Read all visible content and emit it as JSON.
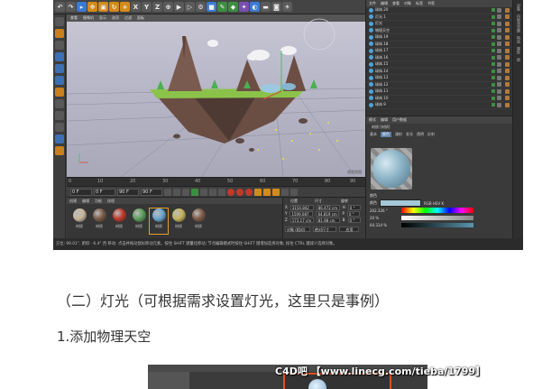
{
  "toolbar": {
    "axis_x": "X",
    "axis_y": "Y",
    "axis_z": "Z"
  },
  "viewport": {
    "menu": [
      "查看",
      "摄像机",
      "显示",
      "选项",
      "过滤",
      "面板"
    ],
    "label": "透视视图"
  },
  "timeline": {
    "ticks": [
      "0",
      "10",
      "20",
      "30",
      "40",
      "50",
      "60",
      "70",
      "80",
      "90"
    ],
    "frame_end_label": "0 F"
  },
  "transport": {
    "start": "0 F",
    "cur": "0 F",
    "end": "90 F",
    "end2": "90 F"
  },
  "materials": {
    "menu": [
      "创建",
      "编辑",
      "功能",
      "纹理"
    ],
    "items": [
      {
        "label": "材质",
        "color": "#c8b89a"
      },
      {
        "label": "材质",
        "color": "#7a5a46"
      },
      {
        "label": "材质",
        "color": "#c0392b"
      },
      {
        "label": "材质",
        "color": "#5ca05a"
      },
      {
        "label": "材质",
        "color": "#6aa6d0"
      },
      {
        "label": "材质",
        "color": "#c7b35a"
      },
      {
        "label": "材质",
        "color": "#7d5c47"
      }
    ]
  },
  "coords": {
    "headers": [
      "位置",
      "尺寸",
      "旋转"
    ],
    "rows": [
      {
        "axis": "X",
        "pos": "3154.842 cm",
        "size": "86.472 cm",
        "rot_label": "H",
        "rot": "0 °"
      },
      {
        "axis": "Y",
        "pos": "1509.087 cm",
        "size": "64.819 cm",
        "rot_label": "P",
        "rot": "0 °"
      },
      {
        "axis": "Z",
        "pos": "173.17 cm",
        "size": "81.98 cm",
        "rot_label": "B",
        "rot": "0 °"
      }
    ],
    "mode_left": "对象 (相对)",
    "mode_mid": "绝对尺寸",
    "apply": "应用"
  },
  "status": "方位: 99.01°, 俯仰: -6.4° 西   移动: 点击并拖动鼠标移动元素。按住 SHIFT 键量化移动; 节点编辑模式时按住 SHIFT 键增加选择对象; 按住 CTRL 键减少选择对象。",
  "object_manager": {
    "tabs": [
      "文件",
      "编辑",
      "查看",
      "对象",
      "标签",
      "书签"
    ],
    "rows": [
      "球体.20",
      "灯光.1",
      "灯光",
      "物理天空",
      "球体.19",
      "球体.18",
      "球体.17",
      "球体.16",
      "球体.15",
      "球体.14",
      "球体.13",
      "球体.12",
      "球体.11",
      "球体.10",
      "球体.9"
    ]
  },
  "attribute_manager": {
    "tabs": [
      "模式",
      "编辑",
      "用户数据"
    ],
    "material_name": "材质 [材质]",
    "channel_tabs": [
      "基本",
      "颜色",
      "漫射",
      "发光",
      "透明",
      "反射"
    ],
    "section": "颜色",
    "color_label": "颜色",
    "mode": "RGB HSV K",
    "H": "202.326 °",
    "S": "20 %",
    "V": "64.314 %"
  },
  "right_strip": [
    "对象",
    "内容浏览器",
    "构造",
    "属性",
    "层"
  ],
  "article": {
    "heading": "（二）灯光（可根据需求设置灯光，这里只是事例）",
    "step": "1.添加物理天空"
  },
  "watermark": "C4D吧 【www.linecg.com/tieba/1799】"
}
